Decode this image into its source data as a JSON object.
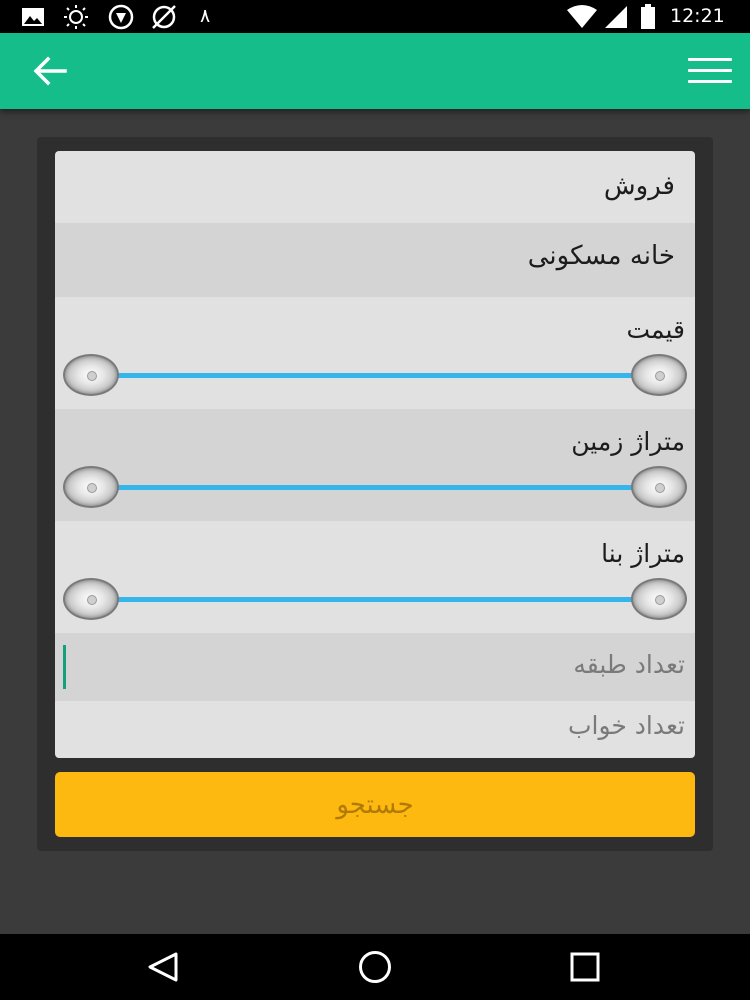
{
  "status_bar": {
    "time": "12:21",
    "notification": "۸",
    "icons": [
      "image-icon",
      "brightness-icon",
      "vpn-shield-icon",
      "data-saver-icon",
      "wifi-icon",
      "cellular-signal-icon",
      "battery-icon"
    ]
  },
  "app_bar": {
    "back_icon": "arrow-left-icon",
    "menu_icon": "hamburger-menu-icon",
    "background": "#14bd8a"
  },
  "form": {
    "transaction_type": "فروش",
    "property_type": "خانه مسکونی",
    "sliders": [
      {
        "label": "قیمت"
      },
      {
        "label": "متراژ زمین"
      },
      {
        "label": "متراژ بنا"
      }
    ],
    "floors_placeholder": "تعداد طبقه",
    "floors_value": "",
    "bedrooms_placeholder": "تعداد خواب",
    "bedrooms_value": ""
  },
  "search_button": {
    "label": "جستجو",
    "color": "#fdb90f"
  },
  "accent_colors": {
    "slider_track": "#35b6ea",
    "cursor": "#14a07a"
  },
  "nav_bar": {
    "icons": [
      "back-triangle-icon",
      "home-circle-icon",
      "recents-square-icon"
    ]
  }
}
